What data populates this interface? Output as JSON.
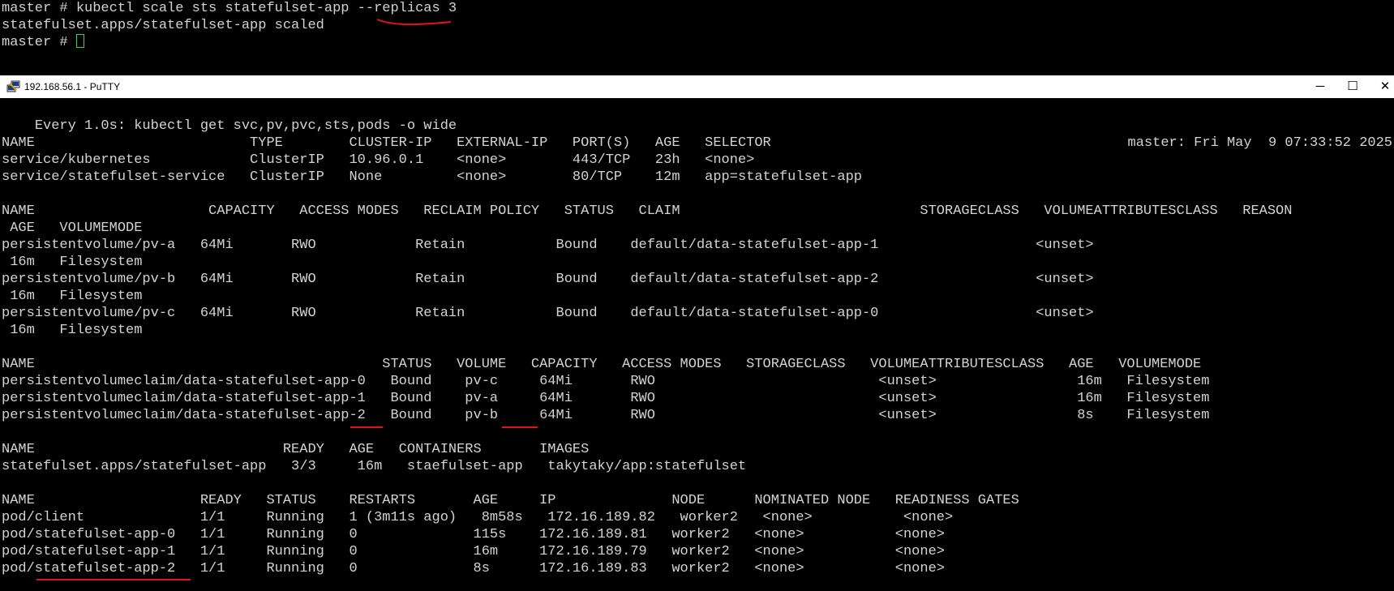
{
  "top_terminal": {
    "lines": [
      "master # kubectl scale sts statefulset-app --replicas 3",
      "statefulset.apps/statefulset-app scaled",
      "master # "
    ]
  },
  "window": {
    "title": "192.168.56.1 - PuTTY",
    "controls": {
      "minimize": "─",
      "maximize": "☐",
      "close": "✕"
    },
    "icon": "putty-icon"
  },
  "watch_header": {
    "left": "Every 1.0s: kubectl get svc,pv,pvc,sts,pods -o wide",
    "right": "master: Fri May  9 07:33:52 2025"
  },
  "lines": [
    "",
    "NAME                          TYPE        CLUSTER-IP   EXTERNAL-IP   PORT(S)   AGE   SELECTOR",
    "service/kubernetes            ClusterIP   10.96.0.1    <none>        443/TCP   23h   <none>",
    "service/statefulset-service   ClusterIP   None         <none>        80/TCP    12m   app=statefulset-app",
    "",
    "NAME                     CAPACITY   ACCESS MODES   RECLAIM POLICY   STATUS   CLAIM                             STORAGECLASS   VOLUMEATTRIBUTESCLASS   REASON",
    " AGE   VOLUMEMODE",
    "persistentvolume/pv-a   64Mi       RWO            Retain           Bound    default/data-statefulset-app-1                   <unset>",
    " 16m   Filesystem",
    "persistentvolume/pv-b   64Mi       RWO            Retain           Bound    default/data-statefulset-app-2                   <unset>",
    " 16m   Filesystem",
    "persistentvolume/pv-c   64Mi       RWO            Retain           Bound    default/data-statefulset-app-0                   <unset>",
    " 16m   Filesystem",
    "",
    "NAME                                          STATUS   VOLUME   CAPACITY   ACCESS MODES   STORAGECLASS   VOLUMEATTRIBUTESCLASS   AGE   VOLUMEMODE",
    "persistentvolumeclaim/data-statefulset-app-0   Bound    pv-c     64Mi       RWO                           <unset>                 16m   Filesystem",
    "persistentvolumeclaim/data-statefulset-app-1   Bound    pv-a     64Mi       RWO                           <unset>                 16m   Filesystem",
    "persistentvolumeclaim/data-statefulset-app-2   Bound    pv-b     64Mi       RWO                           <unset>                 8s    Filesystem",
    "",
    "NAME                              READY   AGE   CONTAINERS       IMAGES",
    "statefulset.apps/statefulset-app   3/3     16m   staefulset-app   takytaky/app:statefulset",
    "",
    "NAME                    READY   STATUS    RESTARTS       AGE     IP              NODE      NOMINATED NODE   READINESS GATES",
    "pod/client              1/1     Running   1 (3m11s ago)   8m58s   172.16.189.82   worker2   <none>           <none>",
    "pod/statefulset-app-0   1/1     Running   0              115s    172.16.189.81   worker2   <none>           <none>",
    "pod/statefulset-app-1   1/1     Running   0              16m     172.16.189.79   worker2   <none>           <none>",
    "pod/statefulset-app-2   1/1     Running   0              8s      172.16.189.83   worker2   <none>           <none>"
  ],
  "colors": {
    "text": "#d3d3d3",
    "background": "#000000",
    "cursor": "#39d353",
    "annotation": "#e0141e"
  }
}
